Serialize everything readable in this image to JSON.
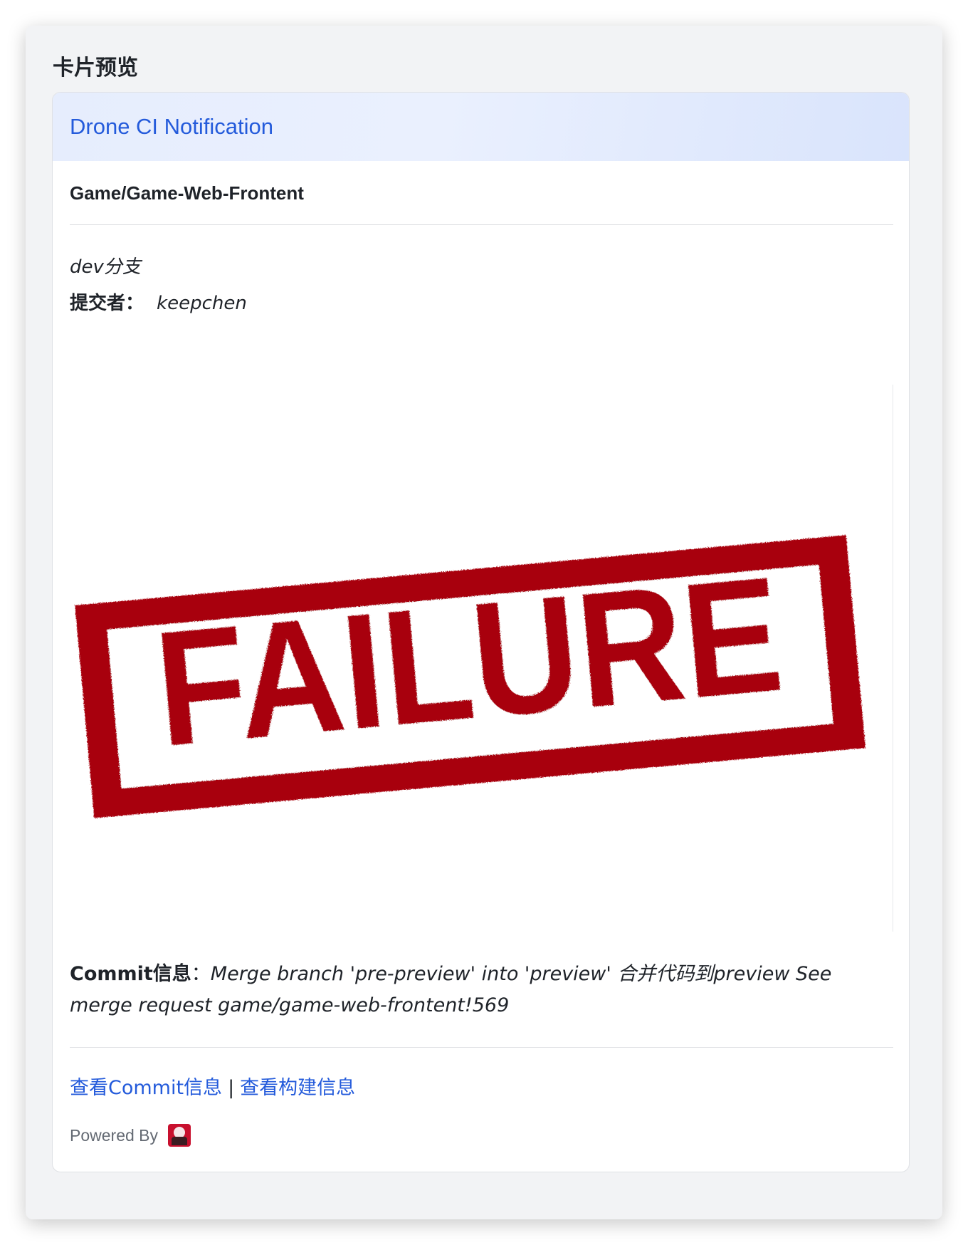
{
  "panel": {
    "title": "卡片预览"
  },
  "card": {
    "header_title": "Drone CI Notification",
    "header_color": "#245bdb",
    "repo": "Game/Game-Web-Frontent",
    "branch": "dev分支",
    "committer_label": "提交者：",
    "committer": "keepchen",
    "image": {
      "stamp_text": "FAILURE",
      "stamp_color": "#a80008"
    },
    "commit_label": "Commit信息",
    "commit_colon": "：",
    "commit_message": "Merge branch 'pre-preview' into 'preview' 合并代码到preview See merge request game/game-web-frontent!569",
    "links": {
      "view_commit": "查看Commit信息",
      "separator": "|",
      "view_build": "查看构建信息"
    },
    "footer": {
      "powered_by": "Powered By",
      "logo_icon": "drone-logo-icon"
    }
  }
}
